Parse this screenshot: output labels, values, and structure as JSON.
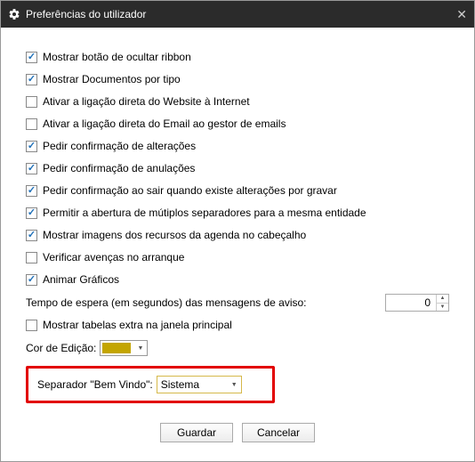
{
  "window": {
    "title": "Preferências do utilizador"
  },
  "options": [
    {
      "label": "Mostrar botão de ocultar ribbon",
      "checked": true,
      "key": "opt-hide-ribbon"
    },
    {
      "label": "Mostrar Documentos por tipo",
      "checked": true,
      "key": "opt-docs-by-type"
    },
    {
      "label": "Ativar a ligação direta do Website à Internet",
      "checked": false,
      "key": "opt-website-direct"
    },
    {
      "label": "Ativar a ligação direta do Email ao gestor de emails",
      "checked": false,
      "key": "opt-email-direct"
    },
    {
      "label": "Pedir confirmação de alterações",
      "checked": true,
      "key": "opt-confirm-changes"
    },
    {
      "label": "Pedir confirmação de anulações",
      "checked": true,
      "key": "opt-confirm-cancel"
    },
    {
      "label": "Pedir confirmação ao sair quando existe alterações por gravar",
      "checked": true,
      "key": "opt-confirm-exit"
    },
    {
      "label": "Permitir a abertura de mútiplos separadores para a mesma entidade",
      "checked": true,
      "key": "opt-multi-tabs"
    },
    {
      "label": "Mostrar imagens dos recursos da agenda no cabeçalho",
      "checked": true,
      "key": "opt-agenda-images"
    },
    {
      "label": "Verificar avenças no arranque",
      "checked": false,
      "key": "opt-check-startup"
    },
    {
      "label": "Animar Gráficos",
      "checked": true,
      "key": "opt-animate-charts"
    }
  ],
  "timeout": {
    "label": "Tempo de espera (em segundos) das mensagens de aviso:",
    "value": "0"
  },
  "extraTables": {
    "label": "Mostrar tabelas extra na janela principal",
    "checked": false
  },
  "editColor": {
    "label": "Cor de Edição:",
    "value": "#c3a500"
  },
  "welcomeTab": {
    "label": "Separador \"Bem Vindo\":",
    "value": "Sistema"
  },
  "buttons": {
    "save": "Guardar",
    "cancel": "Cancelar"
  }
}
